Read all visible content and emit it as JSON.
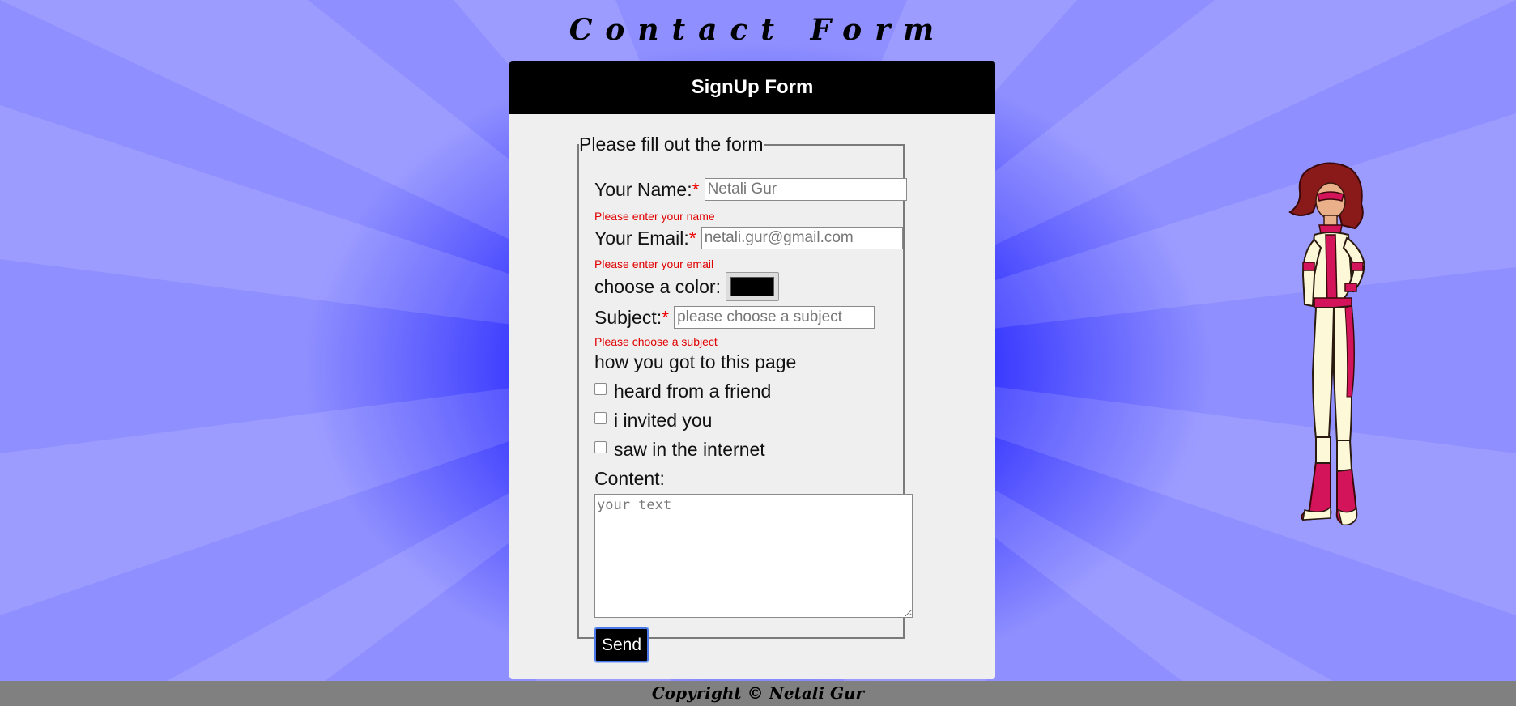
{
  "page": {
    "title": "Contact Form",
    "footer": "Copyright © Netali Gur"
  },
  "card": {
    "header": "SignUp Form",
    "legend": "Please fill out the form"
  },
  "form": {
    "name": {
      "label": "Your Name:",
      "required": "*",
      "placeholder": "Netali Gur",
      "error": "Please enter your name"
    },
    "email": {
      "label": "Your Email:",
      "required": "*",
      "placeholder": "netali.gur@gmail.com",
      "error": "Please enter your email"
    },
    "color": {
      "label": "choose a color:",
      "value": "#000000"
    },
    "subject": {
      "label": "Subject:",
      "required": "*",
      "placeholder": "please choose a subject",
      "error": "Please choose a subject"
    },
    "source": {
      "question": "how you got to this page",
      "options": [
        "heard from a friend",
        "i invited you",
        "saw in the internet"
      ]
    },
    "content": {
      "label": "Content:",
      "placeholder": "your text"
    },
    "send_label": "Send"
  },
  "colors": {
    "error": "#e00000",
    "header_bg": "#000000",
    "card_bg": "#efefef",
    "footer_bg": "#808080",
    "background_center": "#0000ff",
    "hero_suit": "#d4145a",
    "hero_body": "#fdf8d8"
  }
}
